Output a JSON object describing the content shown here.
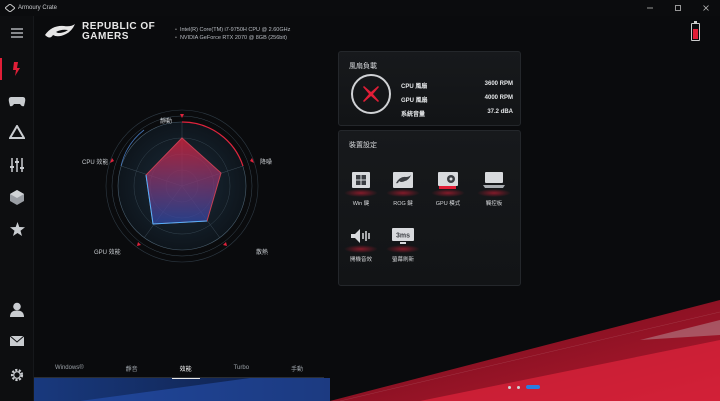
{
  "window": {
    "title": "Armoury Crate",
    "controls": [
      "minimize",
      "maximize",
      "close"
    ]
  },
  "brand": {
    "line1": "REPUBLIC OF",
    "line2": "GAMERS"
  },
  "specs": {
    "cpu": "Intel(R) Core(TM) i7-9750H CPU @ 2.60GHz",
    "gpu": "NVIDIA GeForce RTX 2070 @ 8GB (256bit)"
  },
  "rail": {
    "items": [
      {
        "icon": "hamburger-menu-icon"
      },
      {
        "icon": "device-icon",
        "active": true
      },
      {
        "icon": "gamepad-icon"
      },
      {
        "icon": "triangle-icon"
      },
      {
        "icon": "sliders-icon"
      },
      {
        "icon": "cube-icon"
      },
      {
        "icon": "star-icon"
      },
      {
        "icon": "user-icon"
      },
      {
        "icon": "mail-icon"
      },
      {
        "icon": "settings-icon"
      }
    ]
  },
  "radar": {
    "labels": {
      "top": "靜動",
      "right": "降噪",
      "bottom_right": "散熱",
      "bottom_left": "GPU 效能",
      "left": "CPU 效能"
    }
  },
  "modes": [
    "Windows®",
    "靜音",
    "效能",
    "Turbo",
    "手動"
  ],
  "active_mode": "效能",
  "fan_panel": {
    "title": "風扇負載",
    "rows": [
      {
        "label": "CPU 風扇",
        "value": "3600 RPM"
      },
      {
        "label": "GPU 風扇",
        "value": "4000 RPM"
      },
      {
        "label": "系統音量",
        "value": "37.2 dBA"
      }
    ]
  },
  "device_panel": {
    "title": "裝置設定",
    "tiles": [
      {
        "label": "Win 鍵",
        "icon": "windows-key-icon"
      },
      {
        "label": "ROG 鍵",
        "icon": "rog-key-icon"
      },
      {
        "label": "GPU 模式",
        "icon": "gpu-card-icon"
      },
      {
        "label": "觸控板",
        "icon": "touchpad-icon"
      },
      {
        "label": "開機音效",
        "icon": "boot-sound-icon"
      },
      {
        "label": "螢幕刷新",
        "icon": "display-refresh-icon"
      }
    ]
  },
  "colors": {
    "accent": "#e01e37",
    "blue": "#2b7de0",
    "bg": "#0a0b0d"
  }
}
